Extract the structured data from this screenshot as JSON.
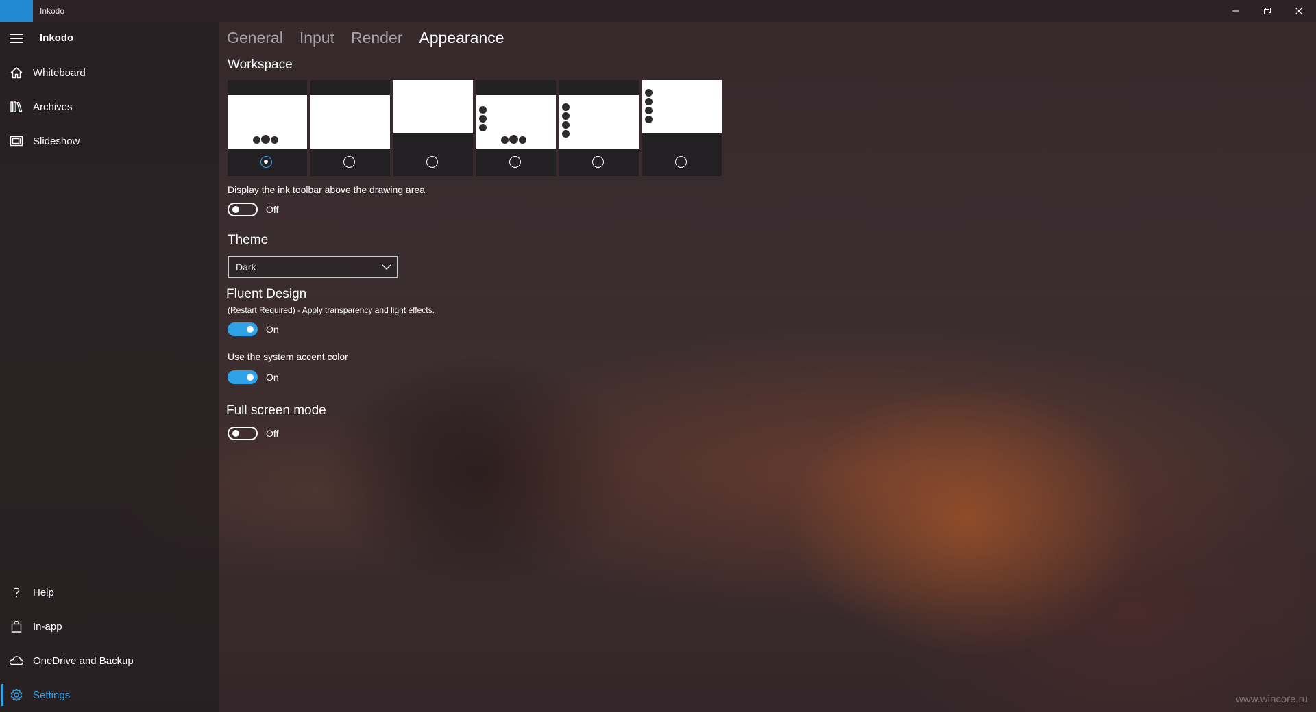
{
  "window": {
    "title": "Inkodo",
    "minimize_glyph": "—",
    "restore_glyph": "❐",
    "close_glyph": "✕"
  },
  "sidebar": {
    "app_name": "Inkodo",
    "items": [
      {
        "label": "Whiteboard",
        "icon": "home-icon"
      },
      {
        "label": "Archives",
        "icon": "library-icon"
      },
      {
        "label": "Slideshow",
        "icon": "slideshow-icon"
      }
    ],
    "footer_items": [
      {
        "label": "Help",
        "icon": "help-icon"
      },
      {
        "label": "In-app",
        "icon": "shopping-bag-icon"
      },
      {
        "label": "OneDrive and Backup",
        "icon": "cloud-icon"
      },
      {
        "label": "Settings",
        "icon": "gear-icon",
        "selected": true
      }
    ]
  },
  "tabs": [
    {
      "label": "General",
      "active": false
    },
    {
      "label": "Input",
      "active": false
    },
    {
      "label": "Render",
      "active": false
    },
    {
      "label": "Appearance",
      "active": true
    }
  ],
  "workspace": {
    "heading": "Workspace",
    "selected_index": 0,
    "layout_count": 6
  },
  "ink_toolbar": {
    "label": "Display the ink toolbar above the drawing area",
    "state": "Off"
  },
  "theme": {
    "heading": "Theme",
    "selected": "Dark"
  },
  "fluent": {
    "heading": "Fluent Design",
    "description": "(Restart Required) - Apply transparency and light effects.",
    "state": "On"
  },
  "accent": {
    "label": "Use the system accent color",
    "state": "On"
  },
  "fullscreen": {
    "heading": "Full screen mode",
    "state": "Off"
  },
  "watermark": "www.wincore.ru",
  "colors": {
    "accent": "#2da2e8",
    "title_icon_block": "#1f8ad2"
  }
}
